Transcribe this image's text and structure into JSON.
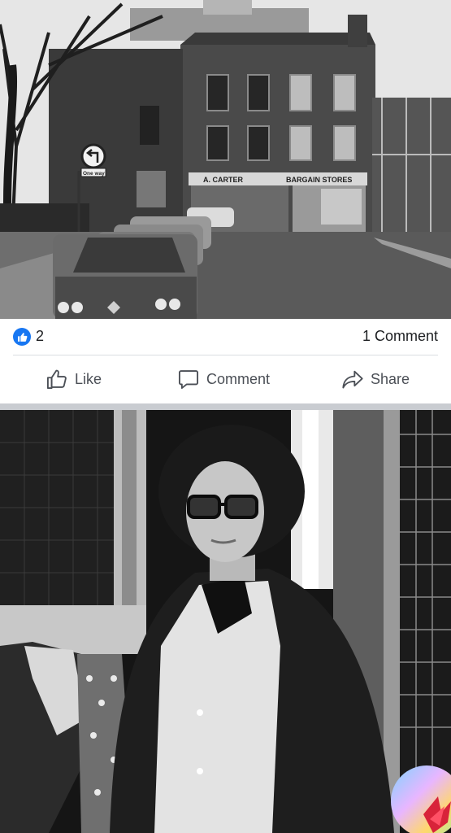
{
  "post": {
    "top_photo": {
      "sign_one_way": "One way",
      "shop_sign_left": "A. CARTER",
      "shop_sign_right": "BARGAIN STORES"
    },
    "reactions": {
      "like_count": "2",
      "comment_count": "1 Comment"
    },
    "actions": {
      "like_label": "Like",
      "comment_label": "Comment",
      "share_label": "Share"
    }
  },
  "colors": {
    "accent": "#1877f2",
    "action_text": "#4b4f56",
    "divider": "#dadde1",
    "separator": "#c9ccd1"
  },
  "icons": {
    "reaction": "thumbs-up-icon",
    "like": "thumbs-up-outline-icon",
    "comment": "speech-bubble-icon",
    "share": "share-arrow-icon"
  }
}
